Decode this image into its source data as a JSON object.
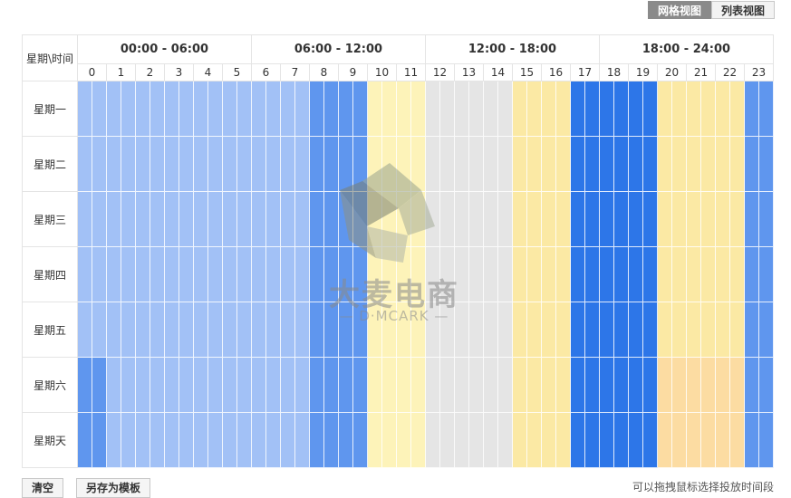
{
  "view_toggle": {
    "grid_label": "网格视图",
    "list_label": "列表视图"
  },
  "header": {
    "corner_label": "星期\\时间",
    "blocks": [
      "00:00 - 06:00",
      "06:00 - 12:00",
      "12:00 - 18:00",
      "18:00 - 24:00"
    ],
    "hours": [
      "0",
      "1",
      "2",
      "3",
      "4",
      "5",
      "6",
      "7",
      "8",
      "9",
      "10",
      "11",
      "12",
      "13",
      "14",
      "15",
      "16",
      "17",
      "18",
      "19",
      "20",
      "21",
      "22",
      "23"
    ]
  },
  "days": [
    "星期一",
    "星期二",
    "星期三",
    "星期四",
    "星期五",
    "星期六",
    "星期天"
  ],
  "colors": {
    "light_blue": "#a2c1f6",
    "mid_blue": "#5f96ee",
    "dark_blue": "#2d76e8",
    "pale_yellow": "#fdf3b9",
    "gray": "#e5e5e5",
    "yellow": "#fbe9a4",
    "orange": "#fcdca2"
  },
  "hour_colors": [
    "light_blue",
    "light_blue",
    "light_blue",
    "light_blue",
    "light_blue",
    "light_blue",
    "light_blue",
    "light_blue",
    "mid_blue",
    "mid_blue",
    "pale_yellow",
    "pale_yellow",
    "gray",
    "gray",
    "gray",
    "yellow",
    "yellow",
    "dark_blue",
    "dark_blue",
    "dark_blue",
    "yellow",
    "yellow",
    "yellow",
    "mid_blue"
  ],
  "overrides": [
    {
      "day": 5,
      "hour": 0,
      "color": "mid_blue"
    },
    {
      "day": 6,
      "hour": 0,
      "color": "mid_blue"
    },
    {
      "day": 5,
      "hour": 20,
      "color": "orange"
    },
    {
      "day": 5,
      "hour": 21,
      "color": "orange"
    },
    {
      "day": 5,
      "hour": 22,
      "color": "orange"
    },
    {
      "day": 6,
      "hour": 20,
      "color": "orange"
    },
    {
      "day": 6,
      "hour": 21,
      "color": "orange"
    },
    {
      "day": 6,
      "hour": 22,
      "color": "orange"
    }
  ],
  "watermark": {
    "brand": "大麦电商",
    "sub": "— D·MCARK —"
  },
  "actions": {
    "clear_label": "清空",
    "save_template_label": "另存为模板"
  },
  "hint": "可以拖拽鼠标选择投放时间段"
}
